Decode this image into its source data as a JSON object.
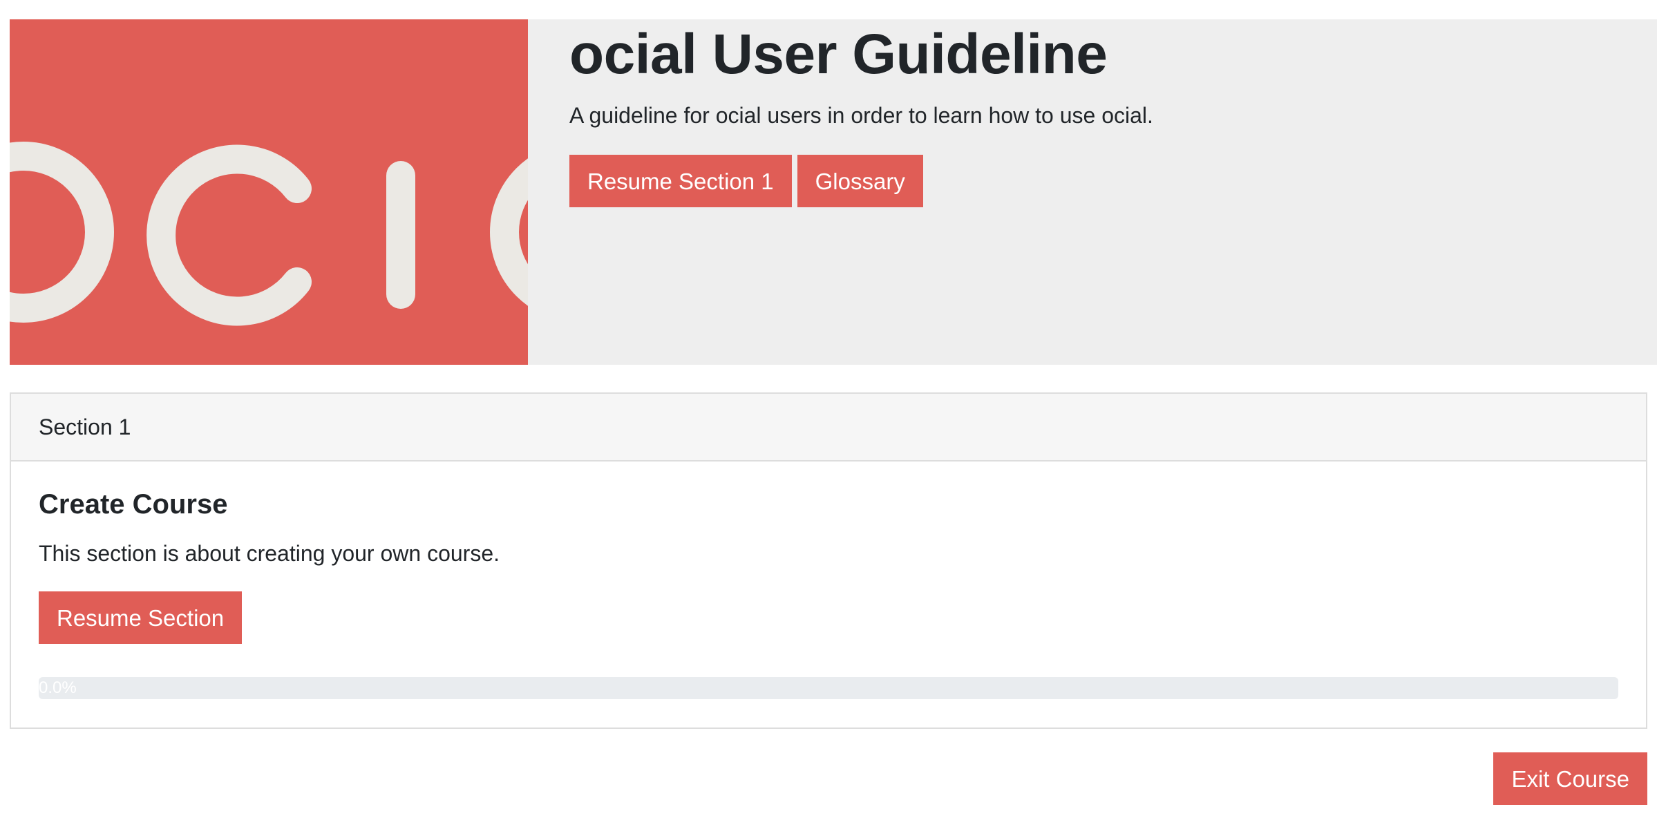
{
  "course": {
    "title": "ocial User Guideline",
    "description": "A guideline for ocial users in order to learn how to use ocial.",
    "resume_button": "Resume Section 1",
    "glossary_button": "Glossary",
    "logo_letters": "OCIO"
  },
  "section": {
    "header": "Section 1",
    "title": "Create Course",
    "description": "This section is about creating your own course.",
    "resume_button": "Resume Section",
    "progress_value": 0.0,
    "progress_label": "0.0%"
  },
  "footer": {
    "exit_button": "Exit Course"
  },
  "colors": {
    "accent": "#e05d56",
    "hero_bg": "#eeeeee",
    "logo_glyph": "#ebe9e4"
  }
}
